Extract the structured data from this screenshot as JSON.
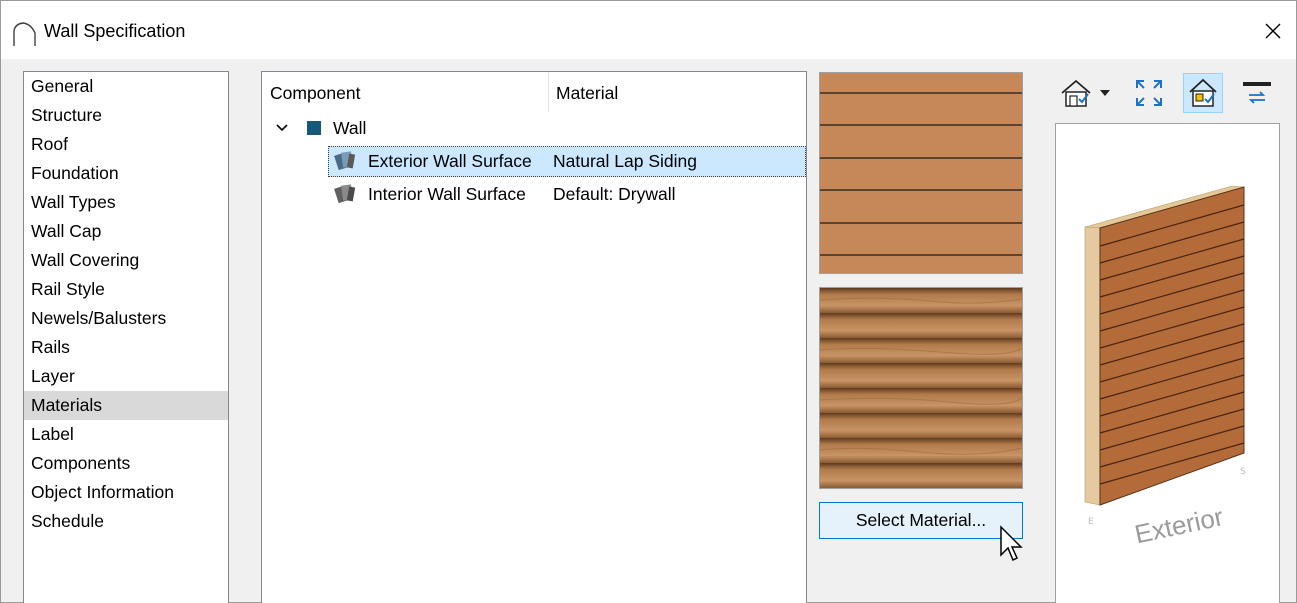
{
  "window": {
    "title": "Wall Specification",
    "close_glyph": "✕"
  },
  "nav": {
    "items": [
      {
        "label": "General"
      },
      {
        "label": "Structure"
      },
      {
        "label": "Roof"
      },
      {
        "label": "Foundation"
      },
      {
        "label": "Wall Types"
      },
      {
        "label": "Wall Cap"
      },
      {
        "label": "Wall Covering"
      },
      {
        "label": "Rail Style"
      },
      {
        "label": "Newels/Balusters"
      },
      {
        "label": "Rails"
      },
      {
        "label": "Layer"
      },
      {
        "label": "Materials"
      },
      {
        "label": "Label"
      },
      {
        "label": "Components"
      },
      {
        "label": "Object Information"
      },
      {
        "label": "Schedule"
      }
    ],
    "selected": "Materials"
  },
  "grid": {
    "columns": [
      "Component",
      "Material"
    ],
    "group": {
      "label": "Wall",
      "color": "#14587a",
      "expanded": true
    },
    "rows": [
      {
        "component": "Exterior Wall Surface",
        "material": "Natural Lap Siding",
        "selected": true,
        "icon": "material-swatches-icon"
      },
      {
        "component": "Interior Wall Surface",
        "material": "Default: Drywall",
        "selected": false,
        "icon": "material-swatches-icon"
      }
    ]
  },
  "material_preview": {
    "flat_color": "#c68858",
    "select_button_label": "Select Material..."
  },
  "preview3d": {
    "toolbar_icons": [
      "house-view-icon",
      "dropdown-arrow-icon",
      "fit-view-icon",
      "interior-exterior-icon",
      "wall-direction-icon"
    ],
    "side_label": "Exterior"
  },
  "colors": {
    "selection": "#cce8ff",
    "accent": "#0078d7",
    "wood": "#c68858"
  }
}
